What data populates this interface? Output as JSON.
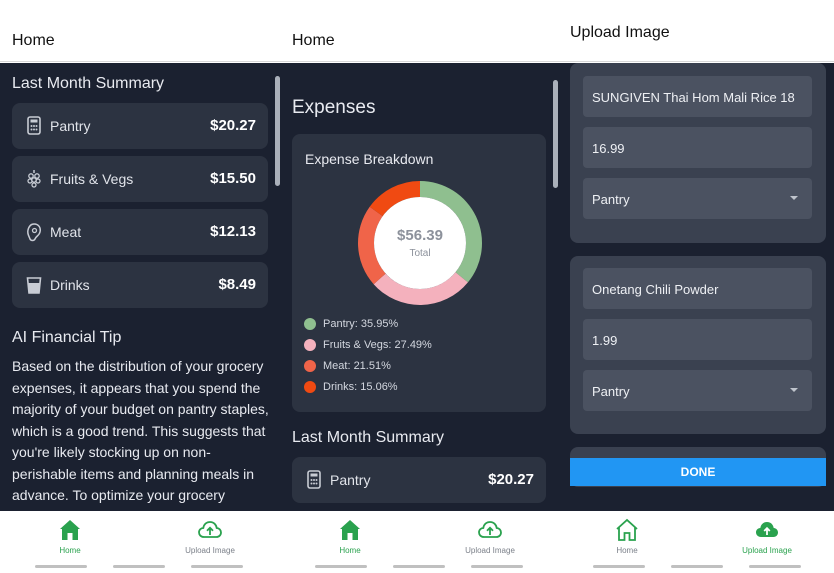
{
  "colors": {
    "background": "#1b2130",
    "card": "#2c3341",
    "accent_green": "#2aa24e",
    "done_blue": "#2196f3",
    "pantry": "#8fbf8f",
    "fruits_vegs": "#f4b1bd",
    "meat": "#f06449",
    "drinks": "#f04a12"
  },
  "screen1": {
    "title": "Home",
    "summary_title": "Last Month Summary",
    "categories": [
      {
        "label": "Pantry",
        "amount": "$20.27",
        "icon": "calculator-icon"
      },
      {
        "label": "Fruits & Vegs",
        "amount": "$15.50",
        "icon": "grapes-icon"
      },
      {
        "label": "Meat",
        "amount": "$12.13",
        "icon": "meat-icon"
      },
      {
        "label": "Drinks",
        "amount": "$8.49",
        "icon": "cup-icon"
      }
    ],
    "tip_title": "AI Financial Tip",
    "tip_text": "Based on the distribution of your grocery expenses, it appears that you spend the majority of your budget on pantry staples, which is a good trend. This suggests that you're likely stocking up on non-perishable items and planning meals in advance. To optimize your grocery"
  },
  "screen2": {
    "title": "Home",
    "expenses_title": "Expenses",
    "breakdown_title": "Expense Breakdown",
    "total_amount": "$56.39",
    "total_label": "Total",
    "legend": [
      {
        "label": "Pantry: 35.95%",
        "color": "#8fbf8f"
      },
      {
        "label": "Fruits & Vegs: 27.49%",
        "color": "#f4b1bd"
      },
      {
        "label": "Meat: 21.51%",
        "color": "#f06449"
      },
      {
        "label": "Drinks: 15.06%",
        "color": "#f04a12"
      }
    ],
    "summary_title": "Last Month Summary",
    "first_category": {
      "label": "Pantry",
      "amount": "$20.27"
    }
  },
  "chart_data": {
    "type": "pie",
    "categories": [
      "Pantry",
      "Fruits & Vegs",
      "Meat",
      "Drinks"
    ],
    "values": [
      35.95,
      27.49,
      21.51,
      15.06
    ],
    "colors": [
      "#8fbf8f",
      "#f4b1bd",
      "#f06449",
      "#f04a12"
    ],
    "title": "Expense Breakdown",
    "center_value": "$56.39",
    "center_label": "Total",
    "legend_placement": "bottom-left"
  },
  "screen3": {
    "title": "Upload Image",
    "items": [
      {
        "name": "SUNGIVEN Thai Hom Mali Rice 18",
        "price": "16.99",
        "category": "Pantry"
      },
      {
        "name": "Onetang Chili Powder",
        "price": "1.99",
        "category": "Pantry"
      }
    ],
    "done_label": "DONE"
  },
  "nav": {
    "home_label": "Home",
    "upload_label": "Upload Image"
  }
}
